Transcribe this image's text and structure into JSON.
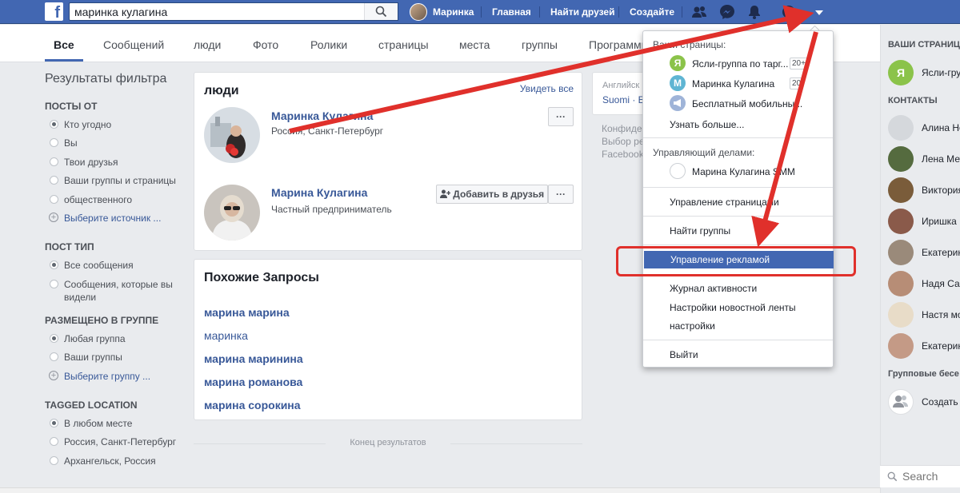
{
  "topbar": {
    "logo": "f",
    "search_value": "маринка кулагина",
    "profile_name": "Маринка",
    "nav_home": "Главная",
    "nav_find_friends": "Найти друзей",
    "nav_create": "Создайте"
  },
  "tabs": [
    "Все",
    "Сообщений",
    "люди",
    "Фото",
    "Ролики",
    "страницы",
    "места",
    "группы",
    "Программы"
  ],
  "left": {
    "title": "Результаты фильтра",
    "posts_from": {
      "title": "ПОСТЫ ОТ",
      "options": [
        "Кто угодно",
        "Вы",
        "Твои друзья",
        "Ваши группы и страницы",
        "общественного"
      ],
      "add": "Выберите источник ..."
    },
    "post_type": {
      "title": "ПОСТ ТИП",
      "options": [
        "Все сообщения",
        "Сообщения, которые вы видели"
      ]
    },
    "posted_in_group": {
      "title": "РАЗМЕЩЕНО В ГРУППЕ",
      "options": [
        "Любая группа",
        "Ваши группы"
      ],
      "add": "Выберите группу ..."
    },
    "tagged_location": {
      "title": "TAGGED LOCATION",
      "options": [
        "В любом месте",
        "Россия, Санкт-Петербург",
        "Архангельск, Россия"
      ]
    }
  },
  "people": {
    "title": "люди",
    "see_all": "Увидеть все",
    "items": [
      {
        "name": "Маринка Кулагина",
        "sub": "Россия, Санкт-Петербург"
      },
      {
        "name": "Марина Кулагина",
        "sub": "Частный предприниматель",
        "add_friend": "Добавить в друзья"
      }
    ],
    "more": "···"
  },
  "similar": {
    "title": "Похожие Запросы",
    "queries": [
      "марина  марина",
      "маринка",
      "марина  маринина",
      "марина  романова",
      "марина  сорокина"
    ]
  },
  "end_results": "Конец результатов",
  "middle": {
    "lang_label": "Английск",
    "lang_link": "Suomi · Es",
    "footer": [
      "Конфиде",
      "Выбор рек",
      "Facebook"
    ]
  },
  "dropdown": {
    "pages_header": "Ваши страницы:",
    "pages": [
      {
        "letter": "Я",
        "name": "Ясли-группа по тарг...",
        "count": "20+",
        "color": "#8bc34a"
      },
      {
        "letter": "М",
        "name": "Маринка Кулагина",
        "count": "20",
        "color": "#5fb5d3"
      },
      {
        "letter": "",
        "name": "Бесплатный мобильны...",
        "count": "",
        "color": "#9fb4d8"
      }
    ],
    "learn_more": "Узнать больше...",
    "business_header": "Управляющий делами:",
    "business_item": "Марина Кулагина SMM",
    "manage_pages": "Управление страницами",
    "find_groups": "Найти группы",
    "manage_ads": "Управление рекламой",
    "activity_log": "Журнал активности",
    "news_feed": "Настройки новостной ленты",
    "settings": "настройки",
    "logout": "Выйти"
  },
  "right": {
    "pages_title": "ВАШИ СТРАНИЦЫ",
    "page_item": "Ясли-груп",
    "contacts_title": "КОНТАКТЫ",
    "contacts": [
      "Алина Но",
      "Лена Мет",
      "Виктория",
      "Иришка П",
      "Екатерин",
      "Надя Сав",
      "Настя мо",
      "Екатерин"
    ],
    "group_chats_title": "Групповые бесе",
    "create": "Создать",
    "search_placeholder": "Search"
  },
  "colors": {
    "brand": "#4267b2",
    "link": "#385898",
    "annotation": "#e0302b"
  }
}
